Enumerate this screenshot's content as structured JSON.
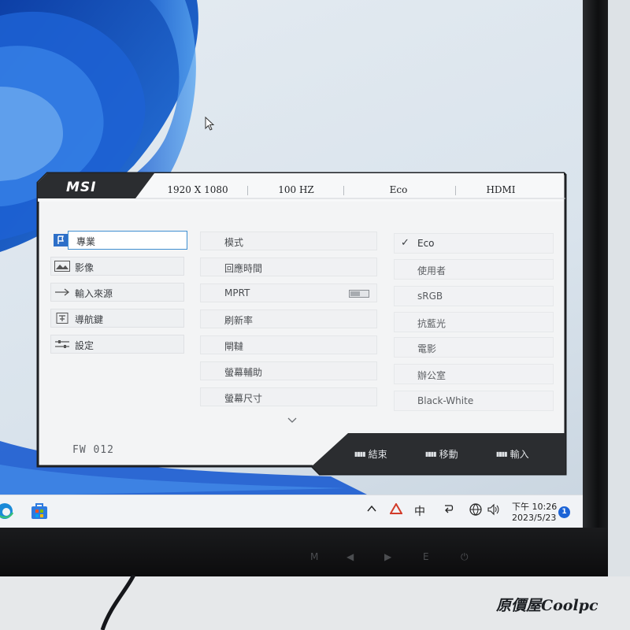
{
  "osd": {
    "brand": "MSI",
    "info_bar": {
      "resolution": "1920 X 1080",
      "refresh": "100 HZ",
      "mode": "Eco",
      "input": "HDMI"
    },
    "categories": [
      {
        "label": "專業",
        "icon": "flag-icon",
        "active": true
      },
      {
        "label": "影像",
        "icon": "image-icon",
        "active": false
      },
      {
        "label": "輸入來源",
        "icon": "arrow-right-icon",
        "active": false
      },
      {
        "label": "導航鍵",
        "icon": "navigation-key-icon",
        "active": false
      },
      {
        "label": "設定",
        "icon": "sliders-icon",
        "active": false
      }
    ],
    "options": [
      {
        "label": "模式"
      },
      {
        "label": "回應時間"
      },
      {
        "label": "MPRT",
        "toggle": "off"
      },
      {
        "label": "刷新率"
      },
      {
        "label": "閘韃"
      },
      {
        "label": "螢幕輔助"
      },
      {
        "label": "螢幕尺寸"
      }
    ],
    "modes": [
      {
        "label": "Eco",
        "selected": true
      },
      {
        "label": "使用者",
        "selected": false
      },
      {
        "label": "sRGB",
        "selected": false
      },
      {
        "label": "抗藍光",
        "selected": false
      },
      {
        "label": "電影",
        "selected": false
      },
      {
        "label": "辦公室",
        "selected": false
      },
      {
        "label": "Black-White",
        "selected": false
      }
    ],
    "more_indicator": "chevron-down-icon",
    "firmware": "FW  012",
    "footer": {
      "exit_label": "結束",
      "move_label": "移動",
      "enter_label": "輸入"
    }
  },
  "taskbar": {
    "apps": [
      "edge-icon",
      "store-icon"
    ],
    "tray": {
      "ime": "中",
      "time": "下午 10:26",
      "date": "2023/5/23",
      "notifications": "1"
    }
  },
  "monitor_buttons": [
    "M",
    "◀",
    "▶",
    "E",
    "⏻"
  ],
  "watermark": "原價屋Coolpc",
  "colors": {
    "osd_header": "#2b2d30",
    "osd_body": "#f3f4f5",
    "accent": "#3f8fd1",
    "wallpaper_blue": "#1557c0"
  }
}
